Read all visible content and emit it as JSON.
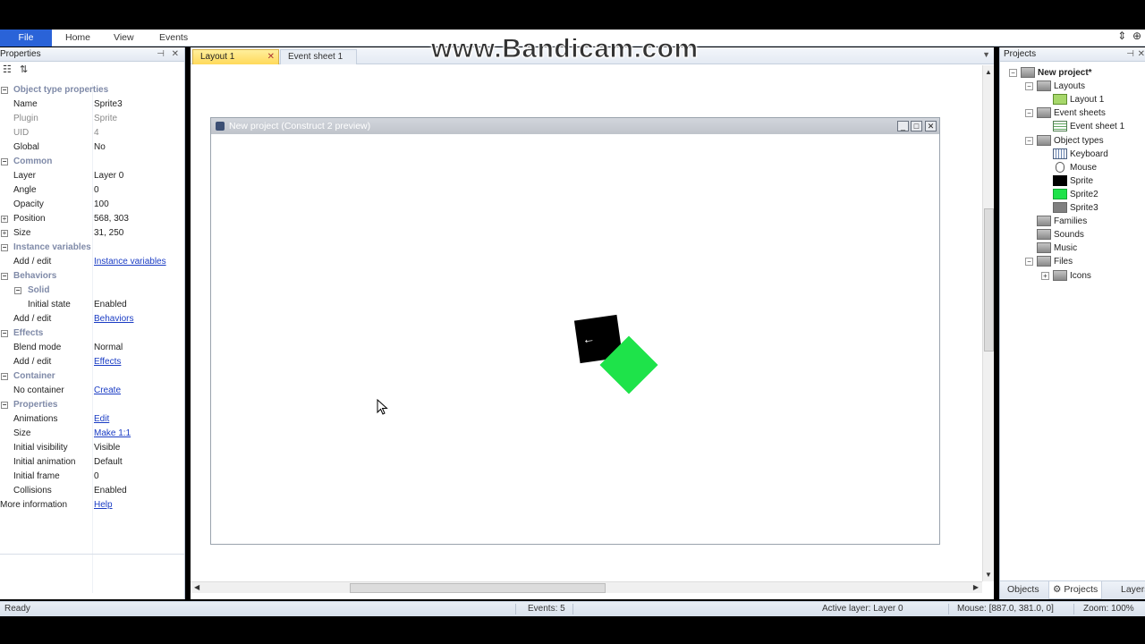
{
  "watermark": "www.Bandicam.com",
  "ribbon": {
    "tabs": [
      "File",
      "Home",
      "View",
      "Events"
    ]
  },
  "properties_panel": {
    "title": "Properties",
    "rows": [
      {
        "type": "cat",
        "key": "Object type properties"
      },
      {
        "key": "Name",
        "value": "Sprite3"
      },
      {
        "key": "Plugin",
        "value": "Sprite",
        "dim": true
      },
      {
        "key": "UID",
        "value": "4",
        "dim": true
      },
      {
        "key": "Global",
        "value": "No"
      },
      {
        "type": "cat",
        "key": "Common"
      },
      {
        "key": "Layer",
        "value": "Layer 0"
      },
      {
        "key": "Angle",
        "value": "0"
      },
      {
        "key": "Opacity",
        "value": "100"
      },
      {
        "key": "Position",
        "value": "568, 303",
        "expand": true
      },
      {
        "key": "Size",
        "value": "31, 250",
        "expand": true
      },
      {
        "type": "cat",
        "key": "Instance variables"
      },
      {
        "key": "Add / edit",
        "value": "Instance variables",
        "link": true
      },
      {
        "type": "cat",
        "key": "Behaviors"
      },
      {
        "type": "subcat",
        "key": "Solid"
      },
      {
        "key": "Initial state",
        "value": "Enabled",
        "sub": true
      },
      {
        "key": "Add / edit",
        "value": "Behaviors",
        "link": true
      },
      {
        "type": "cat",
        "key": "Effects"
      },
      {
        "key": "Blend mode",
        "value": "Normal"
      },
      {
        "key": "Add / edit",
        "value": "Effects",
        "link": true
      },
      {
        "type": "cat",
        "key": "Container"
      },
      {
        "key": "No container",
        "value": "Create",
        "link": true
      },
      {
        "type": "cat",
        "key": "Properties"
      },
      {
        "key": "Animations",
        "value": "Edit",
        "link": true
      },
      {
        "key": "Size",
        "value": "Make 1:1",
        "link": true
      },
      {
        "key": "Initial visibility",
        "value": "Visible"
      },
      {
        "key": "Initial animation",
        "value": "Default"
      },
      {
        "key": "Initial frame",
        "value": "0"
      },
      {
        "key": "Collisions",
        "value": "Enabled"
      },
      {
        "key": "More information",
        "value": "Help",
        "link": true,
        "more": true
      }
    ]
  },
  "document_tabs": [
    {
      "label": "Layout 1",
      "active": true
    },
    {
      "label": "Event sheet 1",
      "active": false
    }
  ],
  "preview": {
    "title": "New project (Construct 2 preview)",
    "sprite_glyph": "←"
  },
  "projects_panel": {
    "title": "Projects",
    "tree": [
      {
        "label": "New project*",
        "level": 0,
        "icon": "folder",
        "exp": "−",
        "highlight": true
      },
      {
        "label": "Layouts",
        "level": 1,
        "icon": "folder",
        "exp": "−"
      },
      {
        "label": "Layout 1",
        "level": 2,
        "icon": "layout"
      },
      {
        "label": "Event sheets",
        "level": 1,
        "icon": "folder",
        "exp": "−"
      },
      {
        "label": "Event sheet 1",
        "level": 2,
        "icon": "eventsheet"
      },
      {
        "label": "Object types",
        "level": 1,
        "icon": "folder",
        "exp": "−"
      },
      {
        "label": "Keyboard",
        "level": 2,
        "icon": "keyboard"
      },
      {
        "label": "Mouse",
        "level": 2,
        "icon": "mouse"
      },
      {
        "label": "Sprite",
        "level": 2,
        "icon": "sprite-black"
      },
      {
        "label": "Sprite2",
        "level": 2,
        "icon": "sprite-green"
      },
      {
        "label": "Sprite3",
        "level": 2,
        "icon": "sprite-gray"
      },
      {
        "label": "Families",
        "level": 1,
        "icon": "folder"
      },
      {
        "label": "Sounds",
        "level": 1,
        "icon": "folder"
      },
      {
        "label": "Music",
        "level": 1,
        "icon": "folder"
      },
      {
        "label": "Files",
        "level": 1,
        "icon": "folder",
        "exp": "−"
      },
      {
        "label": "Icons",
        "level": 2,
        "icon": "folder",
        "exp": "+"
      }
    ],
    "bottom_tabs": [
      "Objects",
      "Projects",
      "Layers"
    ]
  },
  "status": {
    "ready": "Ready",
    "events": "Events: 5",
    "active_layer": "Active layer: Layer 0",
    "mouse": "Mouse: [887.0, 381.0, 0]",
    "zoom": "Zoom: 100%"
  },
  "colors": {
    "file_tab": "#2a63d8",
    "sprite": "#000000",
    "sprite2": "#1ee34a",
    "sprite3": "#808080",
    "link": "#1a3cc4"
  }
}
